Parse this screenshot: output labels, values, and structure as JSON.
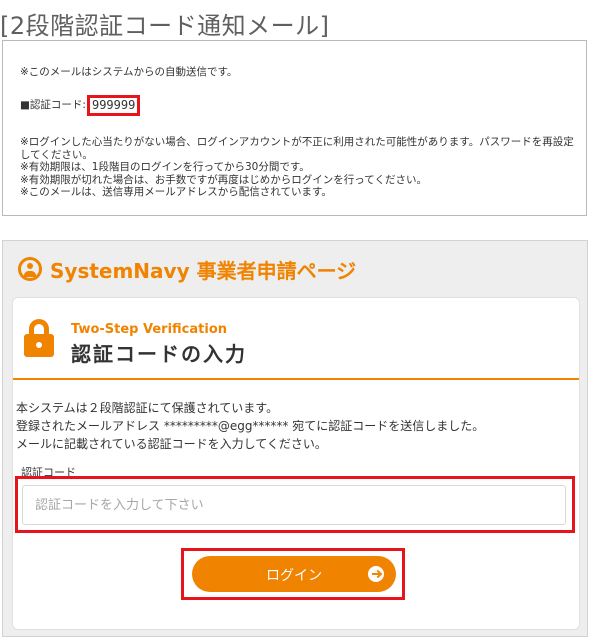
{
  "page_title": "[2段階認証コード通知メール]",
  "mail": {
    "auto_notice": "※このメールはシステムからの自動送信です。",
    "code_label": "■認証コード:",
    "code_value": "999999",
    "notes": [
      "※ログインした心当たりがない場合、ログインアカウントが不正に利用された可能性があります。パスワードを再設定してください。",
      "※有効期限は、1段階目のログインを行ってから30分間です。",
      "※有効期限が切れた場合は、お手数ですが再度はじめからログインを行ってください。",
      "※このメールは、送信専用メールアドレスから配信されています。"
    ]
  },
  "portal": {
    "title": "SystemNavy 事業者申請ページ",
    "step_label": "Two-Step Verification",
    "step_heading": "認証コードの入力",
    "intro": [
      "本システムは２段階認証にて保護されています。",
      "登録されたメールアドレス *********@egg****** 宛てに認証コードを送信しました。",
      "メールに記載されている認証コードを入力してください。"
    ],
    "field_label": "認証コード",
    "input_placeholder": "認証コードを入力して下さい",
    "input_value": "",
    "login_label": "ログイン"
  },
  "colors": {
    "accent": "#f08300",
    "highlight": "#e8141b",
    "panel_background": "#eeeeee"
  },
  "icons": {
    "header": "user-circle-icon",
    "card": "lock-icon",
    "button": "arrow-right-circle-icon"
  }
}
